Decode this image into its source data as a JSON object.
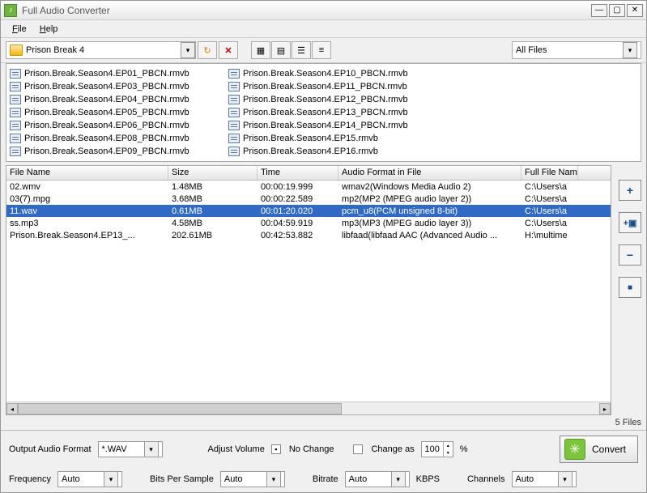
{
  "title": "Full Audio Converter",
  "menus": {
    "file": "File",
    "help": "Help"
  },
  "path": "Prison Break 4",
  "filter": "All Files",
  "browser_files": [
    "Prison.Break.Season4.EP01_PBCN.rmvb",
    "Prison.Break.Season4.EP03_PBCN.rmvb",
    "Prison.Break.Season4.EP04_PBCN.rmvb",
    "Prison.Break.Season4.EP05_PBCN.rmvb",
    "Prison.Break.Season4.EP06_PBCN.rmvb",
    "Prison.Break.Season4.EP08_PBCN.rmvb",
    "Prison.Break.Season4.EP09_PBCN.rmvb",
    "Prison.Break.Season4.EP10_PBCN.rmvb",
    "Prison.Break.Season4.EP11_PBCN.rmvb",
    "Prison.Break.Season4.EP12_PBCN.rmvb",
    "Prison.Break.Season4.EP13_PBCN.rmvb",
    "Prison.Break.Season4.EP14_PBCN.rmvb",
    "Prison.Break.Season4.EP15.rmvb",
    "Prison.Break.Season4.EP16.rmvb"
  ],
  "columns": {
    "name": "File Name",
    "size": "Size",
    "time": "Time",
    "fmt": "Audio Format in File",
    "path": "Full File Name"
  },
  "rows": [
    {
      "name": "02.wmv",
      "size": "1.48MB",
      "time": "00:00:19.999",
      "fmt": "wmav2(Windows Media Audio 2)",
      "path": "C:\\Users\\a",
      "sel": false
    },
    {
      "name": "03(7).mpg",
      "size": "3.68MB",
      "time": "00:00:22.589",
      "fmt": "mp2(MP2 (MPEG audio layer 2))",
      "path": "C:\\Users\\a",
      "sel": false
    },
    {
      "name": "11.wav",
      "size": "0.61MB",
      "time": "00:01:20.020",
      "fmt": "pcm_u8(PCM unsigned 8-bit)",
      "path": "C:\\Users\\a",
      "sel": true
    },
    {
      "name": "ss.mp3",
      "size": "4.58MB",
      "time": "00:04:59.919",
      "fmt": "mp3(MP3 (MPEG audio layer 3))",
      "path": "C:\\Users\\a",
      "sel": false
    },
    {
      "name": "Prison.Break.Season4.EP13_...",
      "size": "202.61MB",
      "time": "00:42:53.882",
      "fmt": "libfaad(libfaad AAC (Advanced Audio ...",
      "path": "H:\\multime",
      "sel": false
    }
  ],
  "file_count": "5 Files",
  "labels": {
    "output_fmt": "Output Audio Format",
    "output_val": "*.WAV",
    "adjust_vol": "Adjust Volume",
    "no_change": "No Change",
    "change_as": "Change as",
    "change_val": "100",
    "pct": "%",
    "convert": "Convert",
    "freq": "Frequency",
    "freq_val": "Auto",
    "bps": "Bits Per Sample",
    "bps_val": "Auto",
    "bitrate": "Bitrate",
    "bitrate_val": "Auto",
    "kbps": "KBPS",
    "channels": "Channels",
    "channels_val": "Auto"
  }
}
